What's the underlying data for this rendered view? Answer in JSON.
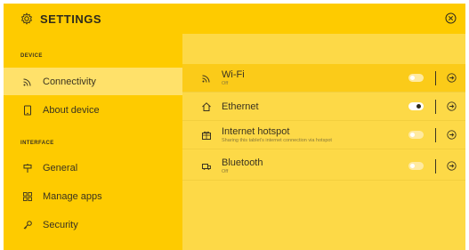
{
  "header": {
    "title": "SETTINGS",
    "settings_icon": "gear-icon",
    "close_icon": "close-circle-icon"
  },
  "sidebar": {
    "sections": [
      {
        "label": "DEVICE"
      },
      {
        "label": "INTERFACE"
      }
    ],
    "items": [
      {
        "label": "Connectivity",
        "icon": "wifi-icon",
        "active": true
      },
      {
        "label": "About device",
        "icon": "tablet-icon",
        "active": false
      },
      {
        "label": "General",
        "icon": "signpost-icon",
        "active": false
      },
      {
        "label": "Manage apps",
        "icon": "apps-grid-icon",
        "active": false
      },
      {
        "label": "Security",
        "icon": "key-icon",
        "active": false
      }
    ]
  },
  "connectivity": {
    "rows": [
      {
        "name": "Wi-Fi",
        "status": "Off",
        "icon": "wifi-icon",
        "enabled": false,
        "selected": true
      },
      {
        "name": "Ethernet",
        "status": "",
        "icon": "home-icon",
        "enabled": true,
        "selected": false
      },
      {
        "name": "Internet hotspot",
        "status": "Sharing this tablet's internet connection via hotspot",
        "icon": "hotspot-icon",
        "enabled": false,
        "selected": false
      },
      {
        "name": "Bluetooth",
        "status": "Off",
        "icon": "bluetooth-device-icon",
        "enabled": false,
        "selected": false
      }
    ]
  },
  "colors": {
    "primary_yellow": "#fecb00",
    "panel_yellow": "#fdd947",
    "active_item": "#ffe16a",
    "text": "#3a3320"
  }
}
